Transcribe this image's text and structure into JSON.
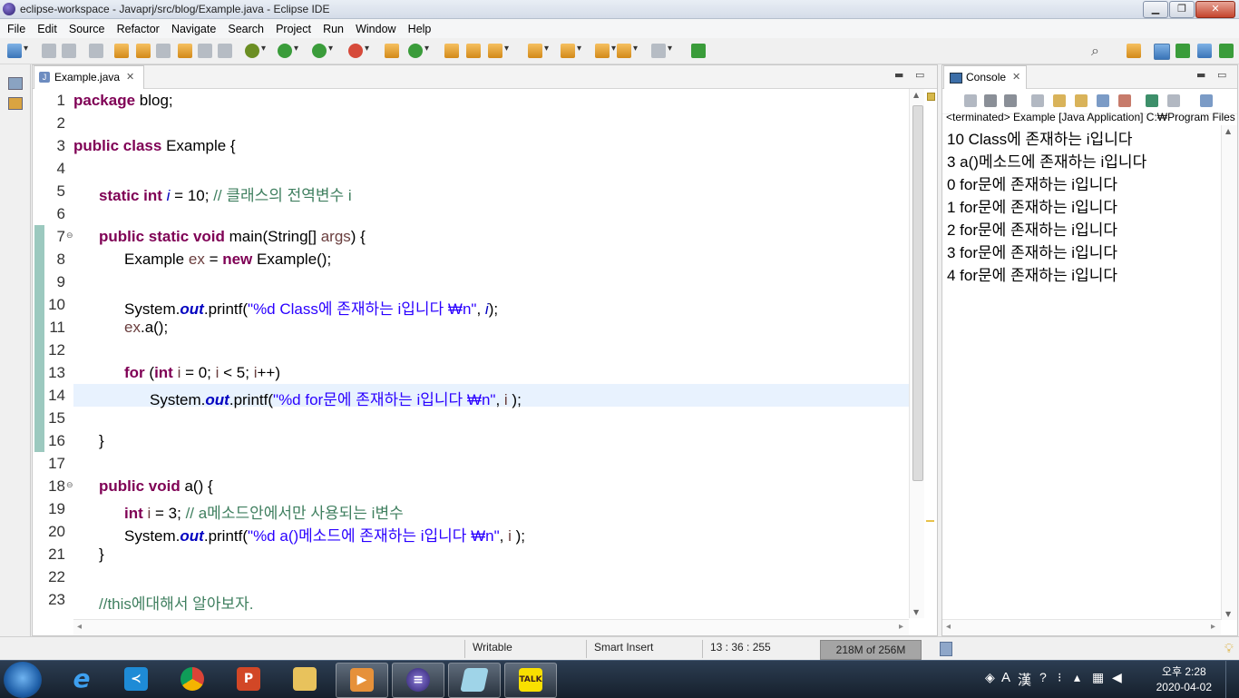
{
  "window": {
    "title": "eclipse-workspace - Javaprj/src/blog/Example.java - Eclipse IDE"
  },
  "menu": [
    "File",
    "Edit",
    "Source",
    "Refactor",
    "Navigate",
    "Search",
    "Project",
    "Run",
    "Window",
    "Help"
  ],
  "editor": {
    "tab_label": "Example.java",
    "line_numbers": [
      "1",
      "2",
      "3",
      "4",
      "5",
      "6",
      "7",
      "8",
      "9",
      "10",
      "11",
      "12",
      "13",
      "14",
      "15",
      "16",
      "17",
      "18",
      "19",
      "20",
      "21",
      "22",
      "23"
    ],
    "lines": {
      "l1a": "package",
      "l1b": " blog;",
      "l3a": "public",
      "l3b": "class",
      "l3c": " Example {",
      "l5a": "static",
      "l5b": "int",
      "l5c": "i",
      "l5d": " = 10; ",
      "l5e": "// 클래스의 전역변수 i",
      "l7a": "public",
      "l7b": "static",
      "l7c": "void",
      "l7d": " main(String[] ",
      "l7e": "args",
      "l7f": ") {",
      "l8a": "Example ",
      "l8b": "ex",
      "l8c": " = ",
      "l8d": "new",
      "l8e": " Example();",
      "l10a": "System.",
      "l10b": "out",
      "l10c": ".printf(",
      "l10d": "\"%d Class에 존재하는 i입니다 ₩n\"",
      "l10e": ", ",
      "l10f": "i",
      "l10g": ");",
      "l11a": "ex",
      "l11b": ".a();",
      "l13a": "for",
      "l13b": " (",
      "l13c": "int",
      "l13d": " i",
      "l13e": " = 0; ",
      "l13f": "i",
      "l13g": " < 5; ",
      "l13h": "i",
      "l13i": "++)",
      "l14a": "System.",
      "l14b": "out",
      "l14c": ".printf(",
      "l14d": "\"%d for문에 존재하는 i입니다 ₩n\"",
      "l14e": ", ",
      "l14f": "i",
      "l14g": " );",
      "l16a": "}",
      "l18a": "public",
      "l18b": "void",
      "l18c": " a() {",
      "l19a": "int",
      "l19b": " i",
      "l19c": " = 3; ",
      "l19d": "// a메소드안에서만 사용되는 i변수",
      "l20a": "System.",
      "l20b": "out",
      "l20c": ".printf(",
      "l20d": "\"%d a()메소드에 존재하는 i입니다 ₩n\"",
      "l20e": ", ",
      "l20f": "i",
      "l20g": " );",
      "l21a": "}",
      "l23a": "//this에대해서 알아보자."
    }
  },
  "console": {
    "tab_label": "Console",
    "terminated": "<terminated> Example [Java Application] C:₩Program Files",
    "output": [
      "10 Class에 존재하는 i입니다",
      "3 a()메소드에 존재하는 i입니다",
      "0 for문에 존재하는 i입니다",
      "1 for문에 존재하는 i입니다",
      "2 for문에 존재하는 i입니다",
      "3 for문에 존재하는 i입니다",
      "4 for문에 존재하는 i입니다"
    ]
  },
  "status": {
    "writable": "Writable",
    "insert_mode": "Smart Insert",
    "position": "13 : 36 : 255",
    "heap": "218M of 256M"
  },
  "taskbar": {
    "time": "오후 2:28",
    "date": "2020-04-02",
    "ime_a": "A",
    "ime_han": "漢",
    "kakao": "TALK",
    "apps": [
      "start-orb-icon",
      "internet-explorer-icon",
      "vscode-icon",
      "chrome-icon",
      "powerpoint-icon",
      "file-explorer-icon",
      "media-player-icon",
      "eclipse-icon",
      "notepad-icon",
      "kakaotalk-icon"
    ]
  }
}
